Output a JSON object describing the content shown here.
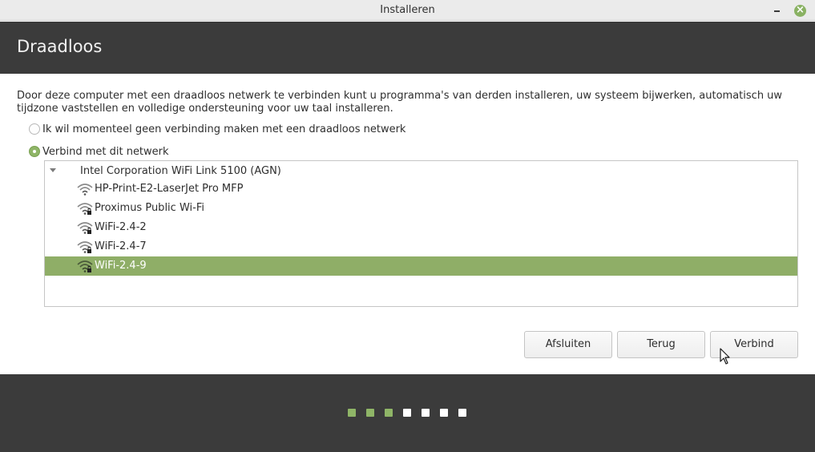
{
  "window": {
    "title": "Installeren",
    "accent_color": "#8fb567"
  },
  "header": {
    "title": "Draadloos"
  },
  "description": "Door deze computer met een draadloos netwerk te verbinden kunt u programma's van derden installeren, uw systeem bijwerken, automatisch uw tijdzone vaststellen en volledige ondersteuning voor uw taal installeren.",
  "options": [
    {
      "label": "Ik wil momenteel geen verbinding maken met een draadloos netwerk",
      "selected": false
    },
    {
      "label": "Verbind met dit netwerk",
      "selected": true
    }
  ],
  "network_list": {
    "device": "Intel Corporation WiFi Link 5100 (AGN)",
    "networks": [
      {
        "name": "HP-Print-E2-LaserJet Pro MFP",
        "secured": false,
        "selected": false,
        "icon": "wifi-signal-icon"
      },
      {
        "name": "Proximus Public Wi-Fi",
        "secured": true,
        "selected": false,
        "icon": "wifi-secure-icon"
      },
      {
        "name": "WiFi-2.4-2",
        "secured": true,
        "selected": false,
        "icon": "wifi-secure-icon"
      },
      {
        "name": "WiFi-2.4-7",
        "secured": true,
        "selected": false,
        "icon": "wifi-secure-icon"
      },
      {
        "name": "WiFi-2.4-9",
        "secured": true,
        "selected": true,
        "icon": "wifi-secure-icon"
      }
    ]
  },
  "buttons": {
    "quit": "Afsluiten",
    "back": "Terug",
    "connect": "Verbind"
  },
  "progress": {
    "total_steps": 7,
    "completed_steps": 3
  }
}
